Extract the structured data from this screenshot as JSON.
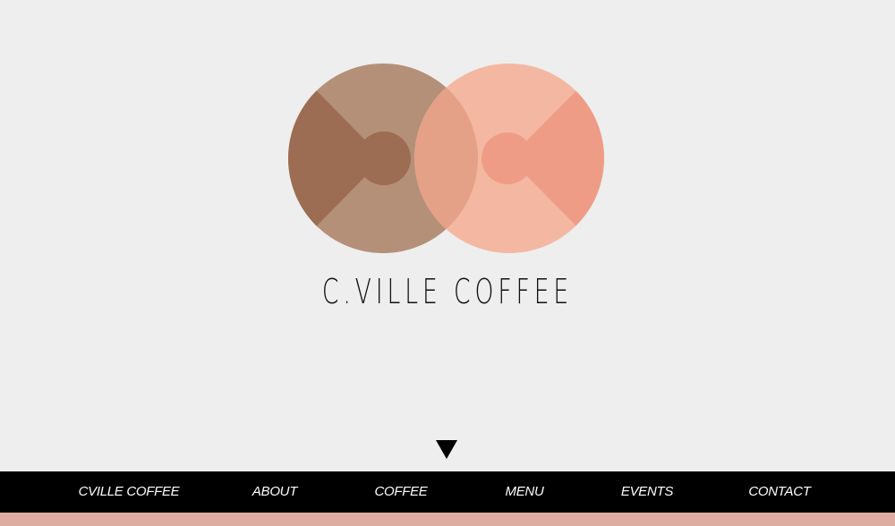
{
  "brand": {
    "wordmark": "C.VILLE COFFEE",
    "logo_icon": "two-overlapping-coffee-cup-circles-icon"
  },
  "scroll": {
    "icon": "triangle-down-icon"
  },
  "nav": {
    "items": [
      {
        "label": "CVILLE COFFEE"
      },
      {
        "label": "ABOUT"
      },
      {
        "label": "COFFEE"
      },
      {
        "label": "MENU"
      },
      {
        "label": "EVENTS"
      },
      {
        "label": "CONTACT"
      }
    ]
  },
  "colors": {
    "background": "#eeeeee",
    "nav_background": "#000000",
    "nav_text": "#ffffff",
    "bottom_strip": "#ddaca2",
    "logo_brown_light": "#b59079",
    "logo_brown_dark": "#9c6d52",
    "logo_pink_light": "#f4b8a2",
    "logo_pink_dark": "#ef9c87",
    "logo_overlap": "#e5a187"
  }
}
